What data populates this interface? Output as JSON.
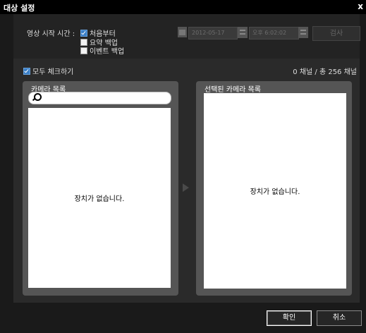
{
  "window": {
    "title": "대상 설정",
    "close_label": "x"
  },
  "start_time": {
    "label": "영상 시작 시간 :",
    "options": [
      {
        "label": "처음부터",
        "checked": true
      },
      {
        "label": "요약 백업",
        "checked": false
      },
      {
        "label": "이벤트 백업",
        "checked": false
      }
    ],
    "date": "2012-05-17",
    "time": "오후  6:02:02",
    "search_label": "검사"
  },
  "check_all": {
    "label": "모두 체크하기",
    "checked": true
  },
  "channel_count": "0 채널 / 총 256 채널",
  "camera_list": {
    "title": "카메라 목록",
    "search_placeholder": "",
    "empty_text": "장치가 없습니다."
  },
  "selected_list": {
    "title": "선택된 카메라 목록",
    "empty_text": "장치가 없습니다."
  },
  "buttons": {
    "ok": "확인",
    "cancel": "취소"
  },
  "colors": {
    "checkbox_accent": "#3b7fc6"
  }
}
